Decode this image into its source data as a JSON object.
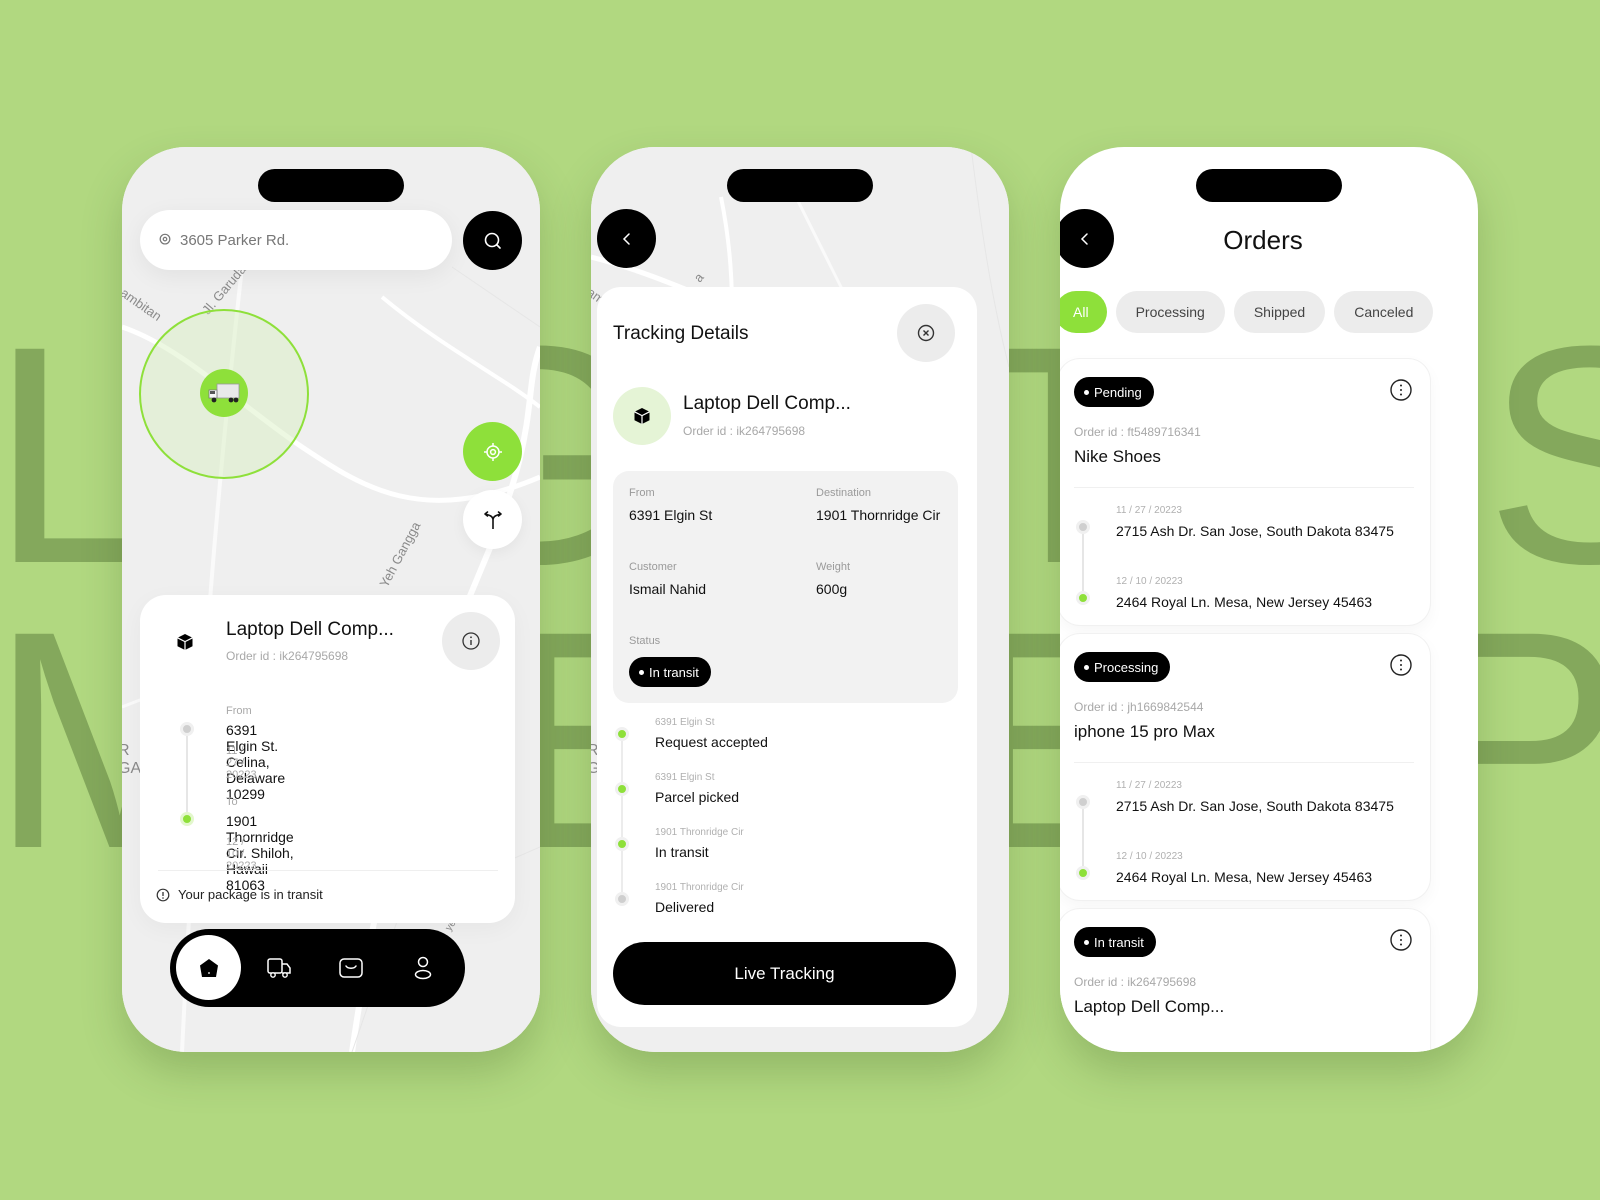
{
  "background": {
    "word_top": "LOGISTICS",
    "word_bottom": "MAP",
    "bg_color": "#b1d880",
    "text_color": "#84a85c",
    "accent": "#8ee03a"
  },
  "phone1": {
    "search": {
      "value": "3605 Parker Rd.",
      "icon": "location-pin-icon"
    },
    "search_button_icon": "search-icon",
    "map_labels": [
      "ambitan",
      "Jl. Garuda",
      "Yeh Gangga",
      "R",
      "GA",
      "yelir"
    ],
    "vehicle_icon": "truck-icon",
    "locate_button_icon": "crosshair-icon",
    "route_button_icon": "route-split-icon",
    "order": {
      "title": "Laptop Dell Comp...",
      "order_id": "Order id : ik264795698",
      "from_label": "From",
      "from_address": "6391 Elgin St. Celina, Delaware 10299",
      "from_date": "11 / 27 / 20223",
      "to_label": "To",
      "to_address": "1901 Thornridge Cir. Shiloh, Hawaii 81063",
      "to_date": "12 / 10 / 20223",
      "note": "Your package is in transit"
    },
    "nav": [
      {
        "name": "home",
        "icon": "home-icon",
        "active": true
      },
      {
        "name": "delivery",
        "icon": "truck-icon",
        "active": false
      },
      {
        "name": "inbox",
        "icon": "inbox-icon",
        "active": false
      },
      {
        "name": "profile",
        "icon": "user-icon",
        "active": false
      }
    ]
  },
  "phone2": {
    "map_labels": [
      "ram",
      "a",
      "R",
      "G"
    ],
    "sheet_title": "Tracking Details",
    "product": {
      "name": "Laptop Dell Comp...",
      "order_id": "Order id : ik264795698"
    },
    "details": {
      "from_label": "From",
      "from_value": "6391 Elgin St",
      "destination_label": "Destination",
      "destination_value": "1901 Thornridge Cir",
      "customer_label": "Customer",
      "customer_value": "Ismail Nahid",
      "weight_label": "Weight",
      "weight_value": "600g",
      "status_label": "Status",
      "status_value": "In transit"
    },
    "steps": [
      {
        "location": "6391 Elgin St",
        "label": "Request accepted",
        "done": true
      },
      {
        "location": "6391 Elgin St",
        "label": "Parcel picked",
        "done": true
      },
      {
        "location": "1901 Thronridge Cir",
        "label": "In transit",
        "done": true
      },
      {
        "location": "1901 Thronridge Cir",
        "label": "Delivered",
        "done": false
      }
    ],
    "live_button": "Live Tracking"
  },
  "phone3": {
    "title": "Orders",
    "filters": [
      {
        "label": "All",
        "active": true
      },
      {
        "label": "Processing",
        "active": false
      },
      {
        "label": "Shipped",
        "active": false
      },
      {
        "label": "Canceled",
        "active": false
      }
    ],
    "orders": [
      {
        "status": "Pending",
        "order_id": "Order id : ft5489716341",
        "name": "Nike Shoes",
        "from_date": "11 / 27 / 20223",
        "from_address": "2715 Ash Dr. San Jose, South Dakota 83475",
        "to_date": "12 / 10 / 20223",
        "to_address": "2464 Royal Ln. Mesa, New Jersey 45463"
      },
      {
        "status": "Processing",
        "order_id": "Order id : jh1669842544",
        "name": "iphone 15 pro Max",
        "from_date": "11 / 27 / 20223",
        "from_address": "2715 Ash Dr. San Jose, South Dakota 83475",
        "to_date": "12 / 10 / 20223",
        "to_address": "2464 Royal Ln. Mesa, New Jersey 45463"
      },
      {
        "status": "In transit",
        "order_id": "Order id : ik264795698",
        "name": "Laptop Dell Comp..."
      }
    ]
  }
}
